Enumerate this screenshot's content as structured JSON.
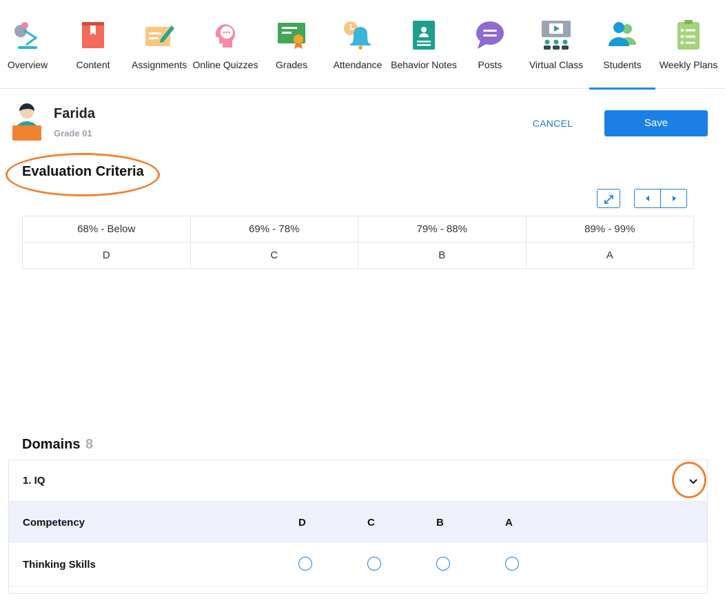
{
  "nav": {
    "items": [
      {
        "label": "Overview",
        "icon": "lamp-icon"
      },
      {
        "label": "Content",
        "icon": "book-icon"
      },
      {
        "label": "Assignments",
        "icon": "pen-paper-icon"
      },
      {
        "label": "Online Quizzes",
        "icon": "head-chat-icon"
      },
      {
        "label": "Grades",
        "icon": "certificate-icon"
      },
      {
        "label": "Attendance",
        "icon": "bell-icon"
      },
      {
        "label": "Behavior Notes",
        "icon": "id-card-icon"
      },
      {
        "label": "Posts",
        "icon": "speech-bubble-icon"
      },
      {
        "label": "Virtual Class",
        "icon": "presentation-icon"
      },
      {
        "label": "Students",
        "icon": "users-icon"
      },
      {
        "label": "Weekly Plans",
        "icon": "clipboard-list-icon"
      }
    ],
    "active": "Students",
    "accent_color": "#1a8fd6"
  },
  "student": {
    "name": "Farida",
    "grade": "Grade 01"
  },
  "actions": {
    "cancel_label": "CANCEL",
    "save_label": "Save",
    "primary_color": "#1a80e5"
  },
  "evaluation": {
    "title": "Evaluation Criteria",
    "ranges": [
      "68% - Below",
      "69% - 78%",
      "79% - 88%",
      "89% - 99%"
    ],
    "grades": [
      "D",
      "C",
      "B",
      "A"
    ]
  },
  "domains": {
    "title": "Domains",
    "count": "8",
    "items": [
      {
        "name": "1. IQ",
        "header": {
          "competency_label": "Competency",
          "grades": [
            "D",
            "C",
            "B",
            "A"
          ]
        },
        "rows": [
          {
            "competency": "Thinking Skills",
            "selected": null
          }
        ]
      }
    ]
  },
  "annotation_color": "#f08232"
}
